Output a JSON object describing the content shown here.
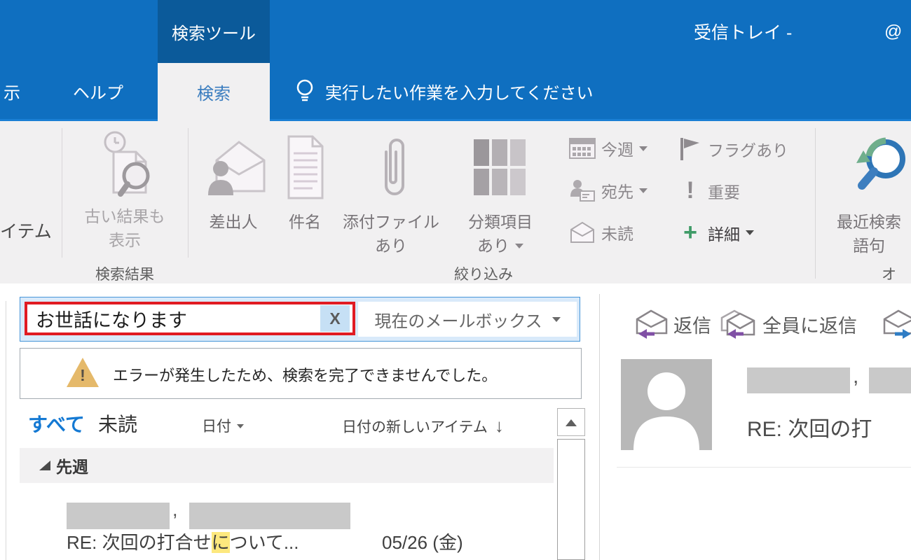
{
  "titlebar": {
    "contextual_tab": "検索ツール",
    "inbox_title": "受信トレイ -",
    "at_sign": "@"
  },
  "tabs": {
    "view_partial": "示",
    "help": "ヘルプ",
    "search": "検索",
    "tell_me": "実行したい作業を入力してください"
  },
  "ribbon": {
    "all_items_partial": "イテム",
    "old_results_line1": "古い結果も",
    "old_results_line2": "表示",
    "from": "差出人",
    "subject": "件名",
    "attach_line1": "添付ファイル",
    "attach_line2": "あり",
    "categorized_line1": "分類項目",
    "categorized_line2": "あり",
    "this_week": "今週",
    "to": "宛先",
    "unread": "未読",
    "flagged": "フラグあり",
    "important": "重要",
    "important_mark": "!",
    "more": "詳細",
    "more_plus": "+",
    "recent_line1": "最近検索",
    "recent_line2": "語句",
    "group_results": "検索結果",
    "group_refine": "絞り込み",
    "group_options_partial": "オ"
  },
  "search": {
    "query": "お世話になります",
    "clear_label": "X",
    "scope": "現在のメールボックス"
  },
  "warning": {
    "mark": "!",
    "message": "エラーが発生したため、検索を完了できませんでした。"
  },
  "list": {
    "filter_all": "すべて",
    "filter_unread": "未読",
    "sort_field": "日付",
    "sort_order": "日付の新しいアイテム",
    "sort_arrow": "↓",
    "group_label": "先週",
    "item": {
      "comma": ",",
      "subject_pre": "RE: 次回の打合せ",
      "subject_highlight": "に",
      "subject_post": "ついて...",
      "date": "05/26 (金)"
    }
  },
  "reading": {
    "reply": "返信",
    "reply_all": "全員に返信",
    "comma": ",",
    "subject": "RE: 次回の打"
  },
  "colors": {
    "accent_blue": "#0f6fc0",
    "contextual_blue": "#0b5a9a",
    "highlight_red": "#e11b22",
    "warning_tan": "#e5b96a",
    "search_fill": "#d9eafa",
    "match_yellow": "#fde87e",
    "plus_green": "#3f9b67",
    "reply_purple": "#8050a5",
    "forward_blue": "#2e7cc4"
  }
}
